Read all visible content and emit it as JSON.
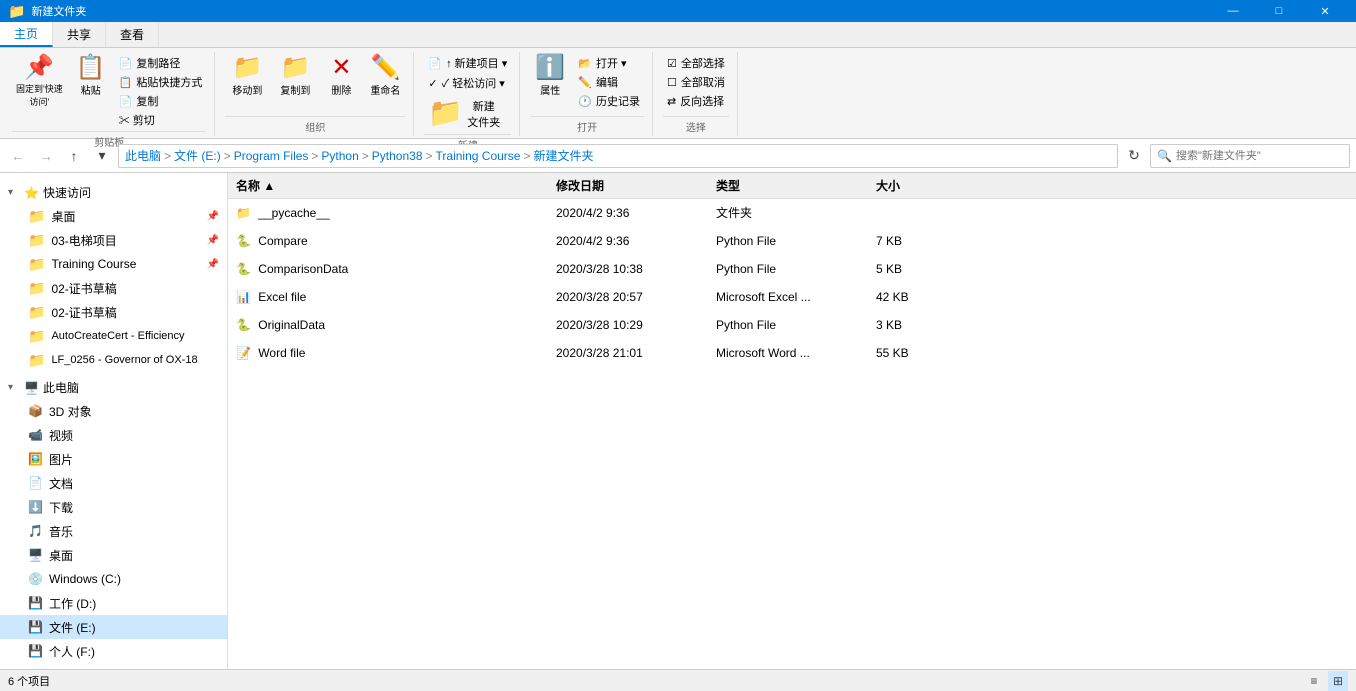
{
  "titlebar": {
    "title": "新建文件夹",
    "min": "—",
    "max": "□",
    "close": "✕"
  },
  "ribbon": {
    "tabs": [
      "主页",
      "共享",
      "查看"
    ],
    "active_tab": "主页",
    "groups": {
      "clipboard": {
        "label": "剪贴板",
        "pin_label": "固定到'快速访问'",
        "copy_label": "复制",
        "paste_label": "粘贴",
        "copy_path": "复制路径",
        "paste_shortcut": "粘贴快捷方式",
        "cut_label": "✂ 剪切"
      },
      "organize": {
        "label": "组织",
        "move_label": "移动到",
        "copy_label": "复制到",
        "delete_label": "删除",
        "rename_label": "重命名"
      },
      "new": {
        "label": "新建",
        "new_item_label": "↑ 新建项目 ▾",
        "easy_access": "✓ 轻松访问 ▾",
        "new_folder_label": "新建\n文件夹"
      },
      "open": {
        "label": "打开",
        "open_label": "打开 ▾",
        "edit_label": "编辑",
        "history_label": "历史记录",
        "properties_label": "属性"
      },
      "select": {
        "label": "选择",
        "select_all": "全部选择",
        "select_none": "全部取消",
        "invert": "反向选择"
      }
    }
  },
  "addressbar": {
    "breadcrumbs": [
      "此电脑",
      "文件 (E:)",
      "Program Files",
      "Python",
      "Python38",
      "Training Course",
      "新建文件夹"
    ],
    "search_placeholder": "搜索\"新建文件夹\""
  },
  "sidebar": {
    "quick_access_label": "快速访问",
    "quick_items": [
      {
        "label": "桌面",
        "pinned": true
      },
      {
        "label": "03-电梯项目",
        "pinned": true
      },
      {
        "label": "Training Course",
        "pinned": true
      },
      {
        "label": "02-证书草稿",
        "pinned": false
      },
      {
        "label": "02-证书草稿",
        "pinned": false
      },
      {
        "label": "AutoCreateCert - Efficiency",
        "pinned": false
      },
      {
        "label": "LF_0256 - Governor of OX-18",
        "pinned": false
      }
    ],
    "pc_label": "此电脑",
    "pc_items": [
      {
        "label": "3D 对象"
      },
      {
        "label": "视频"
      },
      {
        "label": "图片"
      },
      {
        "label": "文档"
      },
      {
        "label": "下载"
      },
      {
        "label": "音乐"
      },
      {
        "label": "桌面"
      }
    ],
    "drives": [
      {
        "label": "Windows (C:)",
        "type": "system"
      },
      {
        "label": "工作 (D:)",
        "type": "work"
      },
      {
        "label": "文件 (E:)",
        "type": "files",
        "selected": true
      },
      {
        "label": "个人 (F:)",
        "type": "personal"
      }
    ]
  },
  "files": {
    "headers": [
      "名称",
      "修改日期",
      "类型",
      "大小"
    ],
    "items": [
      {
        "name": "__pycache__",
        "date": "2020/4/2 9:36",
        "type": "文件夹",
        "size": "",
        "icon": "folder"
      },
      {
        "name": "Compare",
        "date": "2020/4/2 9:36",
        "type": "Python File",
        "size": "7 KB",
        "icon": "python"
      },
      {
        "name": "ComparisonData",
        "date": "2020/3/28 10:38",
        "type": "Python File",
        "size": "5 KB",
        "icon": "python"
      },
      {
        "name": "Excel file",
        "date": "2020/3/28 20:57",
        "type": "Microsoft Excel ...",
        "size": "42 KB",
        "icon": "excel"
      },
      {
        "name": "OriginalData",
        "date": "2020/3/28 10:29",
        "type": "Python File",
        "size": "3 KB",
        "icon": "python"
      },
      {
        "name": "Word file",
        "date": "2020/3/28 21:01",
        "type": "Microsoft Word ...",
        "size": "55 KB",
        "icon": "word"
      }
    ]
  },
  "statusbar": {
    "count_label": "6 个项目"
  }
}
